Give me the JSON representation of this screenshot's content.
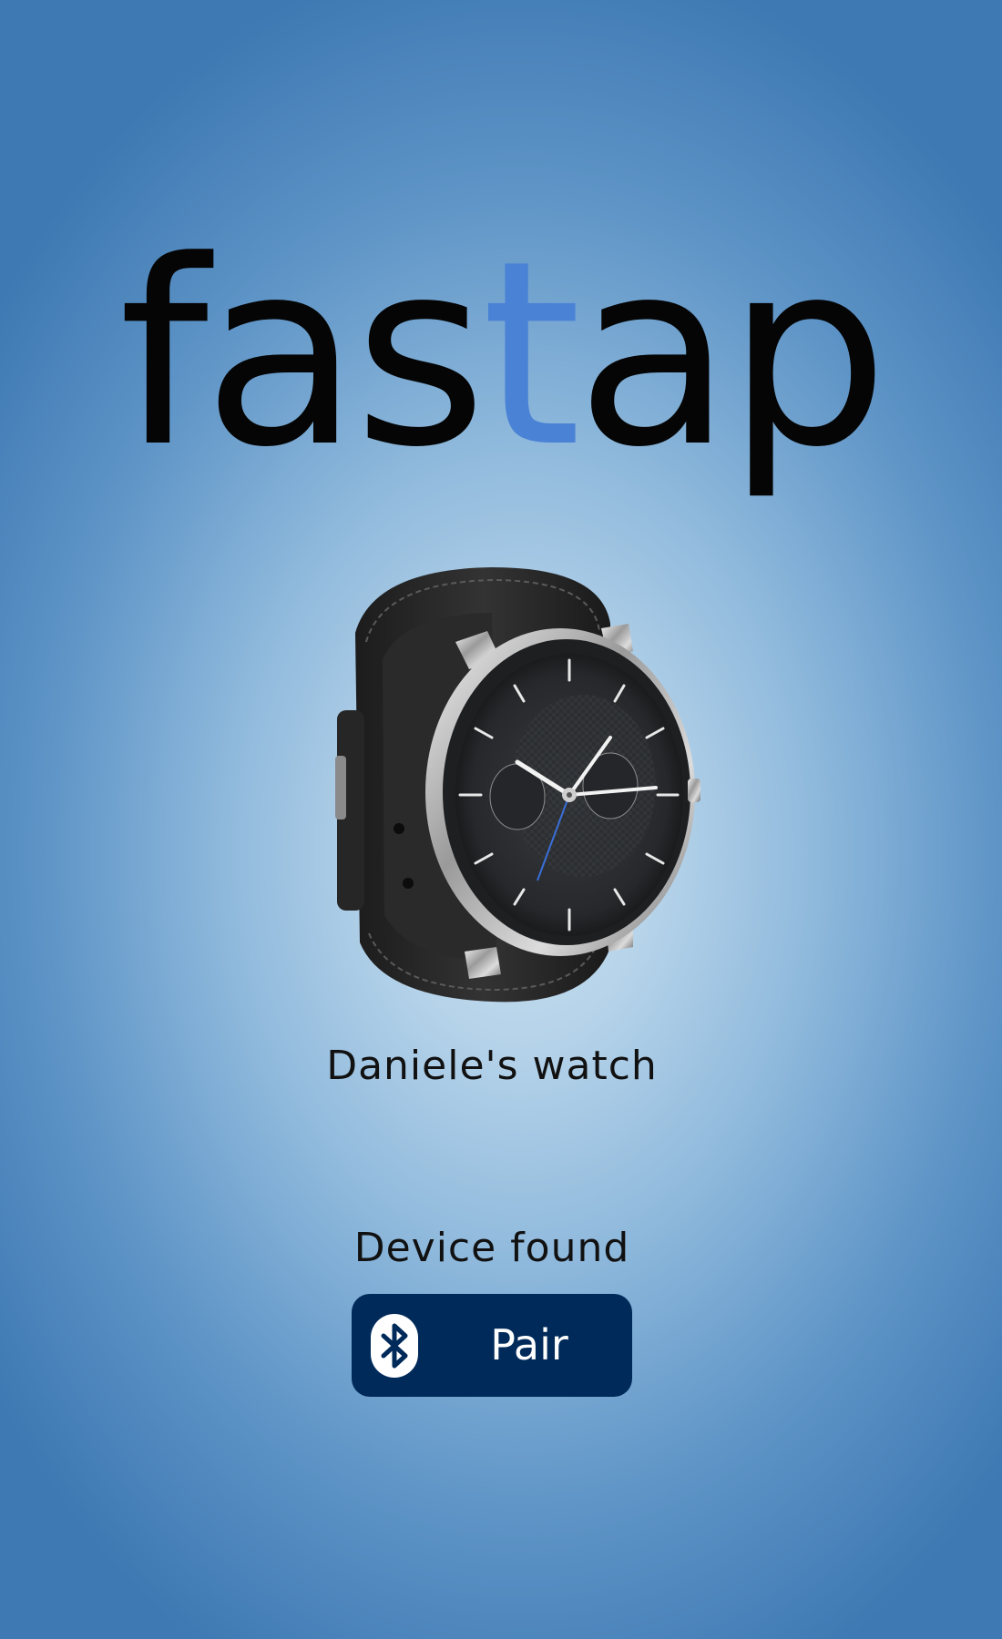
{
  "logo": {
    "part1": "fas",
    "part2": "t",
    "part3": "ap"
  },
  "device": {
    "name": "Daniele's watch"
  },
  "status": {
    "text": "Device found"
  },
  "pair_button": {
    "label": "Pair",
    "icon": "bluetooth-icon"
  },
  "colors": {
    "logo_text": "#050505",
    "logo_accent": "#4a82d6",
    "button_bg": "#002a5a",
    "button_text": "#ffffff",
    "background_center": "#cfe3f2",
    "background_edge": "#3e79b3"
  }
}
